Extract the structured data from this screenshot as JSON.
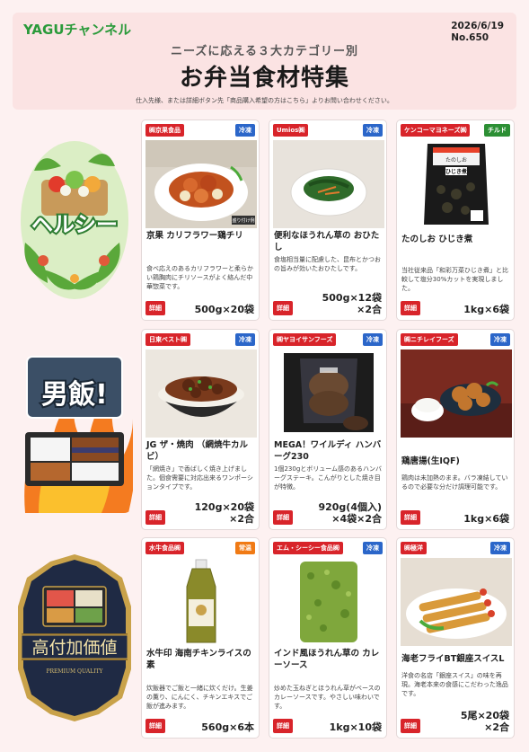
{
  "header": {
    "brand": "YAGUチャンネル",
    "date": "2026/6/19",
    "issue": "No.650",
    "subtitle": "ニーズに応える３大カテゴリー別",
    "title": "お弁当食材特集",
    "note": "仕入先様、または詳細ボタン先「商品購入希望の方はこちら」よりお問い合わせください。"
  },
  "sections": [
    {
      "label": "ヘルシー",
      "icon": "healthy-badge-icon"
    },
    {
      "label": "男飯!",
      "icon": "otoko-meshi-badge-icon"
    },
    {
      "label": "高付加価値",
      "sub": "PREMIUM QUALITY",
      "icon": "premium-badge-icon"
    }
  ],
  "products": [
    {
      "maker": "㈱京果食品",
      "storage": "冷凍",
      "name": "京果 カリフラワー鶏チリ",
      "desc": "食べ応えのあるカリフラワーと柔らかい鶏胸肉にチリソースがよく絡んだ中華惣菜です。",
      "qty": "500g×20袋",
      "photo_icon": "chili-chicken-photo-icon",
      "photo_tag": "盛り付け例"
    },
    {
      "maker": "Umios㈱",
      "storage": "冷凍",
      "name": "便利なほうれん草の おひたし",
      "desc": "食塩相当量に配慮した、昆布とかつおの旨みが効いたおひたしです。",
      "qty1": "500g×12袋",
      "qty2": "×2合",
      "photo_icon": "spinach-ohitashi-photo-icon"
    },
    {
      "maker": "ケンコーマヨネーズ㈱",
      "storage": "チルド",
      "name": "たのしお ひじき煮",
      "desc": "当社従来品「和彩万菜ひじき煮」と比較して塩分30%カットを実現しました。",
      "qty": "1kg×6袋",
      "photo_icon": "hijiki-package-photo-icon",
      "pkg_label": "ひじき煮",
      "pkg_brand": "たのしお"
    },
    {
      "maker": "日東ベスト㈱",
      "storage": "冷凍",
      "name": "JG ザ・焼肉 （網焼牛カルビ）",
      "desc": "「網焼き」で香ばしく焼き上げました。個食需要に対応出来るワンポーションタイプです。",
      "qty1": "120g×20袋",
      "qty2": "×2合",
      "photo_icon": "yakiniku-bowl-photo-icon"
    },
    {
      "maker": "㈱ヤヨイサンフーズ",
      "storage": "冷凍",
      "name": "MEGA！ワイルディ ハンバーグ230",
      "desc": "1個230gとボリューム感のあるハンバーグステーキ。こんがりとした焼き目が特徴。",
      "qty1": "920g(4個入)",
      "qty2": "×4袋×2合",
      "photo_icon": "hamburg-package-photo-icon"
    },
    {
      "maker": "㈱ニチレイフーズ",
      "storage": "冷凍",
      "name": "鶏唐揚(生IQF)",
      "desc": "鶏肉は未加熱のまま。バラ凍結しているので必要な分だけ調理可能です。",
      "qty": "1kg×6袋",
      "photo_icon": "karaage-photo-icon"
    },
    {
      "maker": "水牛食品㈱",
      "storage": "常温",
      "name": "水牛印 海南チキンライスの素",
      "desc": "炊飯器でご飯と一緒に炊くだけ。生姜の薫り、にんにく、チキンエキスでご飯が進みます。",
      "qty": "560g×6本",
      "photo_icon": "sauce-bottle-photo-icon"
    },
    {
      "maker": "エム・シーシー食品㈱",
      "storage": "冷凍",
      "name": "インド風ほうれん草の カレーソース",
      "desc": "炒めた玉ねぎとほうれん草がベースのカレーソースです。やさしい味わいです。",
      "qty": "1kg×10袋",
      "photo_icon": "spinach-curry-pouch-photo-icon"
    },
    {
      "maker": "㈱極洋",
      "storage": "冷凍",
      "name": "海老フライBT銀座スイスL",
      "desc": "洋食の名店「銀座スイス」の味を再現。海老本来の食感にこだわった逸品です。",
      "qty1": "5尾×20袋",
      "qty2": "×2合",
      "photo_icon": "ebi-fry-photo-icon"
    }
  ],
  "detail_label": "詳細",
  "colors": {
    "accent": "#d8242a",
    "frozen": "#2b66c9",
    "chilled": "#2c8f34",
    "ambient": "#f07a14",
    "brand": "#2a9a3a",
    "header_bg": "#fbe3e3"
  }
}
